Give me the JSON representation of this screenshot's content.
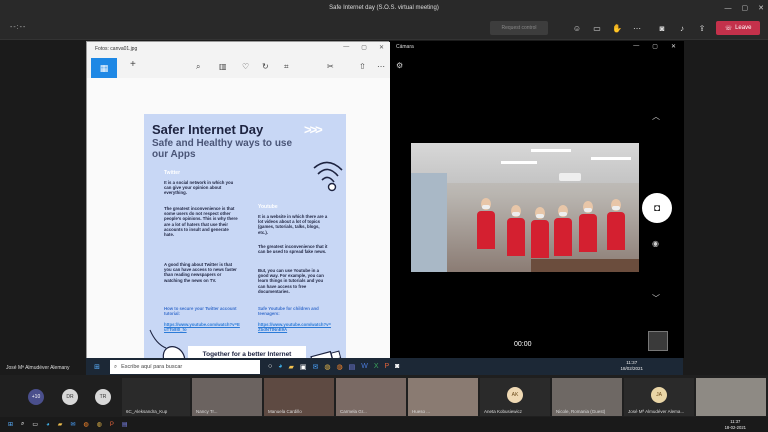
{
  "window": {
    "title": "Safe Internet day (S.O.S. virtual meeting)",
    "min": "—",
    "max": "▢",
    "close": "✕"
  },
  "meeting_toolbar": {
    "timer": "--:--",
    "request_control": "Request control",
    "leave_label": "Leave",
    "icons": [
      "participants-icon",
      "chat-icon",
      "raise-hand-icon",
      "more-icon",
      "camera-icon",
      "mic-icon",
      "share-icon"
    ]
  },
  "photos_app": {
    "title": "Fotos: canva01.jpg",
    "toolbar_icons": [
      "home-icon",
      "add-icon",
      "zoom-icon",
      "delete-icon",
      "favorite-icon",
      "rotate-icon",
      "crop-icon",
      "edit-icon",
      "share-icon",
      "more-icon"
    ]
  },
  "poster": {
    "title": "Safer Internet Day",
    "subtitle": "Safe and Healthy ways to use our Apps",
    "twitter_heading": "Twitter",
    "twitter_p1": "It is a social network in which you can give your opinion about everything.",
    "twitter_p2": "The greatest inconvenience is that some users do not respect other people's opinions. This is why there are a lot of haters that use their accounts to insult and generate hate.",
    "twitter_p3": "A good thing about Twitter is that you can have access to news faster than reading newspapers or watching the news on TV.",
    "twitter_secure": "How to secure your Twitter account tutorial:",
    "twitter_link": "https://www.youtube.com/watch?v=EuTTo8l0_fo",
    "youtube_heading": "Youtube",
    "youtube_p1": "It is a website in which there are a lot videos about a lot of topics (games, tutorials, talks, blogs, etc.).",
    "youtube_p2": "The greatest inconvenience that it can be used to spread fake news.",
    "youtube_p3": "But, you can use Youtube in a good way. For example, you can learn things in tutorials and you can have access to free documentaries.",
    "youtube_secure": "Safe Youtube for children and teenagers:",
    "youtube_link": "https://www.youtube.com/watch?v=ZbdNTtNnE9A",
    "banner": "Together for a better Internet"
  },
  "camera_app": {
    "title": "Cámara",
    "timer": "00:00"
  },
  "presenter_label": "José Mª Almudéver Alemany",
  "shared_taskbar": {
    "search_placeholder": "Escribe aquí para buscar",
    "time": "11:37",
    "date": "18/02/2021"
  },
  "participants": {
    "more_count": "+10",
    "avatars": [
      {
        "initials": "DR",
        "color": "#d8d8d8"
      },
      {
        "initials": "TR",
        "color": "#d8d8d8"
      },
      {
        "initials": "6",
        "color": "#d8d8d8"
      }
    ],
    "tiles": [
      {
        "name": "6C_Aleksandra_Kup"
      },
      {
        "name": "Nancy Tr..."
      },
      {
        "name": "Manuela Cardillo"
      },
      {
        "name": "Carmela Gr..."
      },
      {
        "name": "Hueso ..."
      },
      {
        "name": "Aneta Kobusiewicz",
        "initials": "AK"
      },
      {
        "name": "Nicole, Romania (Guest)"
      },
      {
        "name": "José Mª Almudéver Alema...",
        "initials": "JA"
      },
      {
        "name": ""
      }
    ]
  },
  "local_taskbar": {
    "time": "11:37",
    "date": "18-02-2021"
  }
}
